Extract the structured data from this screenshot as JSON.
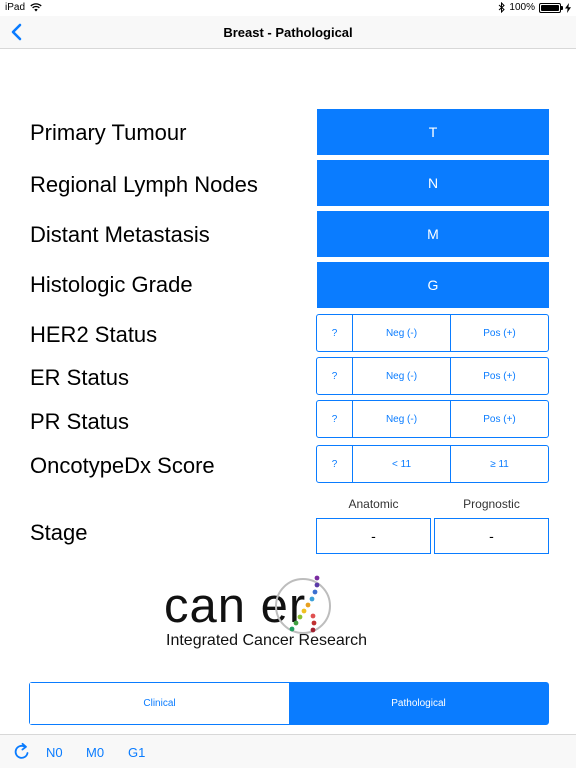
{
  "status_bar": {
    "device": "iPad",
    "time": "",
    "battery": "100%",
    "battery_level": 1.0
  },
  "nav": {
    "title": "Breast - Pathological"
  },
  "tnm": [
    {
      "label": "Primary Tumour",
      "button": "T"
    },
    {
      "label": "Regional Lymph Nodes",
      "button": "N"
    },
    {
      "label": "Distant Metastasis",
      "button": "M"
    },
    {
      "label": "Histologic Grade",
      "button": "G"
    }
  ],
  "markers": [
    {
      "label": "HER2 Status",
      "options": [
        "?",
        "Neg (-)",
        "Pos (+)"
      ]
    },
    {
      "label": "ER Status",
      "options": [
        "?",
        "Neg (-)",
        "Pos (+)"
      ]
    },
    {
      "label": "PR Status",
      "options": [
        "?",
        "Neg (-)",
        "Pos (+)"
      ]
    },
    {
      "label": "OncotypeDx Score",
      "options": [
        "?",
        "< 11",
        "≥ 11"
      ]
    }
  ],
  "stage": {
    "label": "Stage",
    "anatomic_header": "Anatomic",
    "prognostic_header": "Prognostic",
    "anatomic_value": "-",
    "prognostic_value": "-"
  },
  "logo": {
    "word": "can er",
    "subtitle": "Integrated Cancer Research"
  },
  "mode": {
    "clinical": "Clinical",
    "pathological": "Pathological",
    "selected": "Pathological"
  },
  "toolbar": {
    "items": [
      "N0",
      "M0",
      "G1"
    ]
  },
  "colors": {
    "accent": "#0a7cff"
  }
}
